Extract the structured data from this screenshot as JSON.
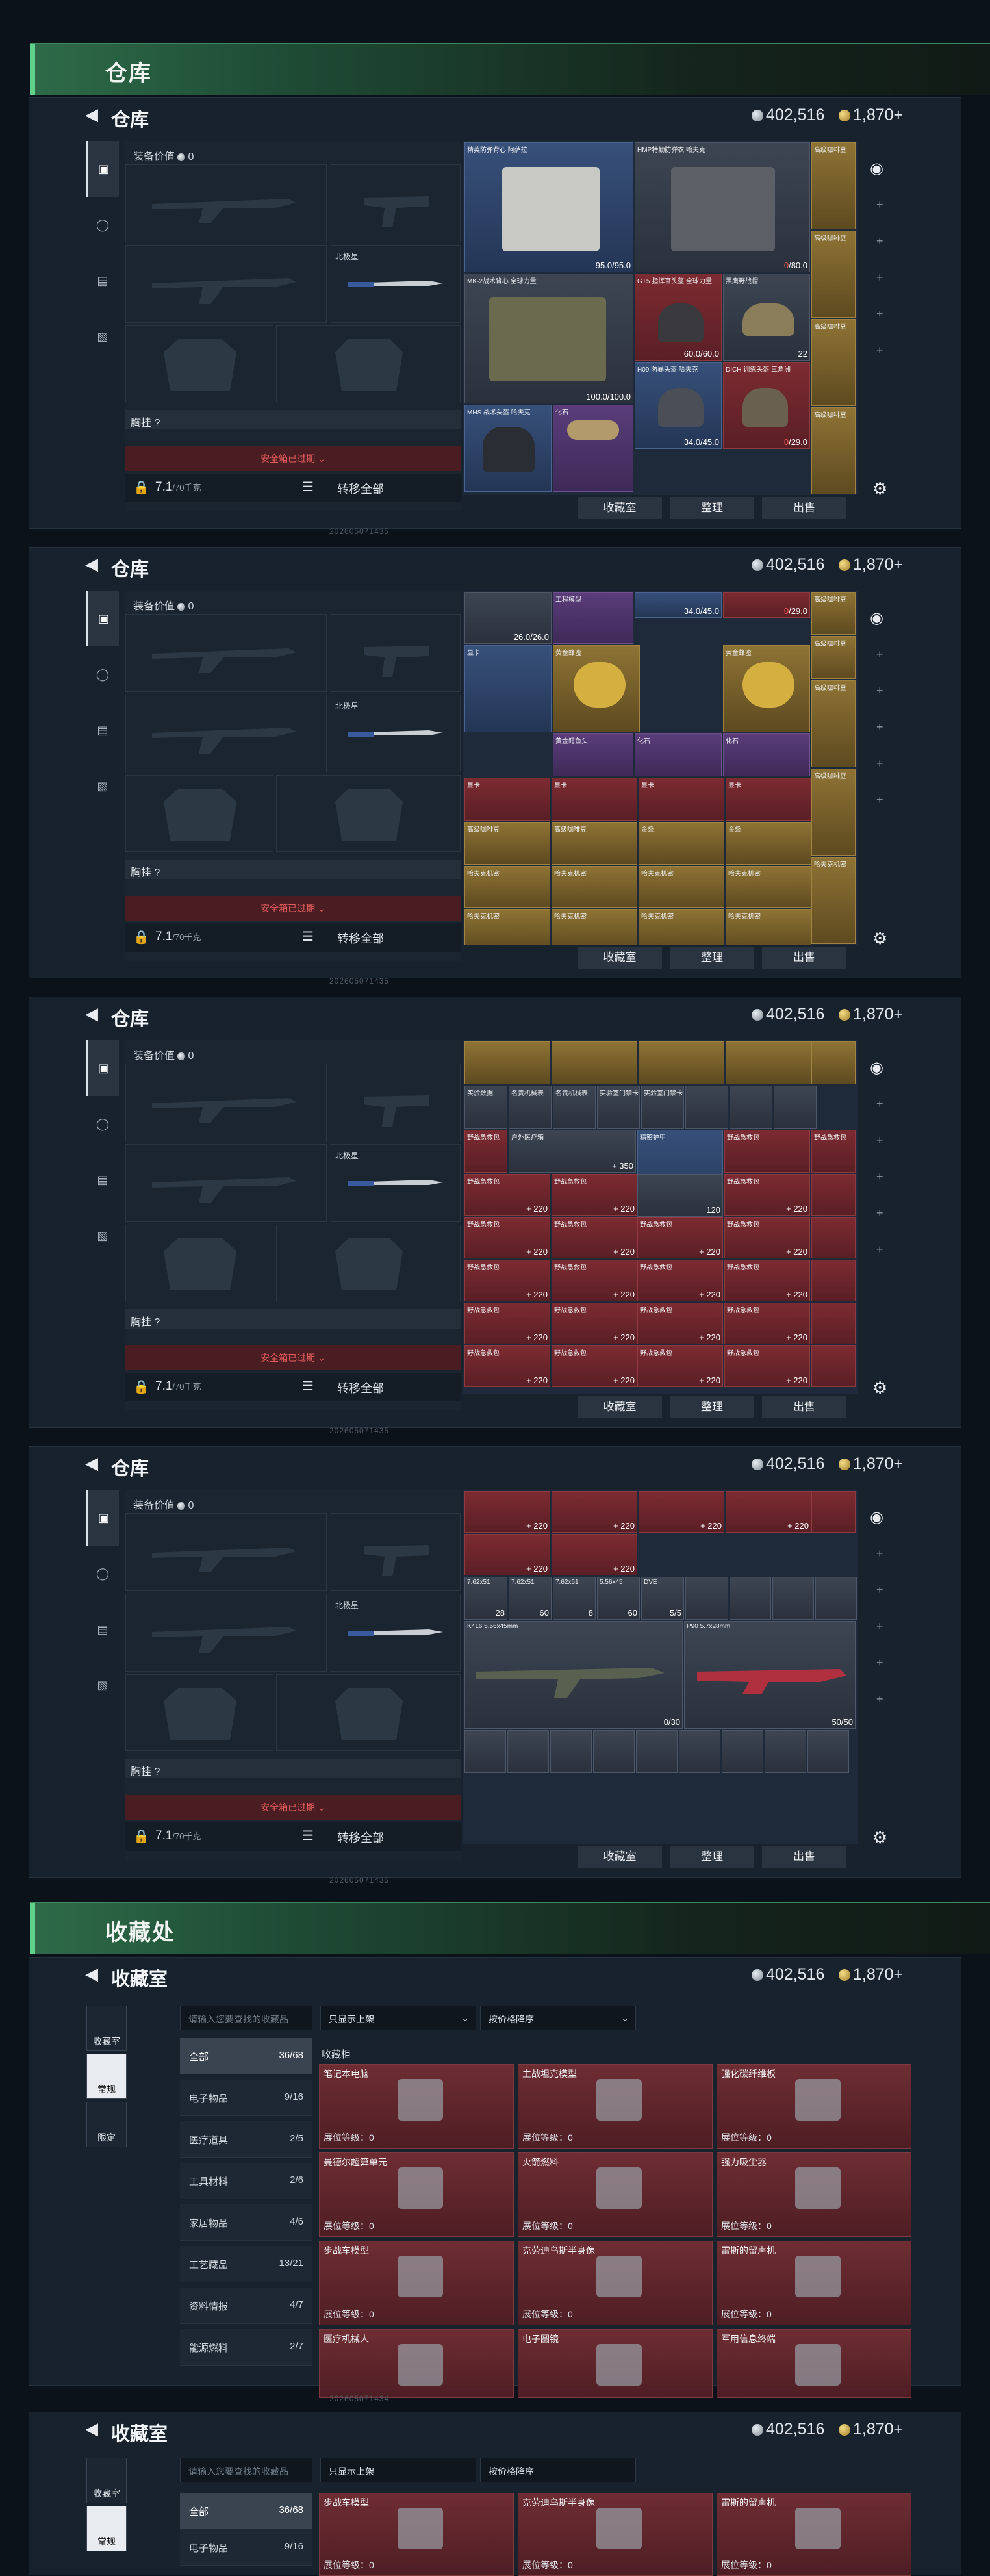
{
  "sections": {
    "warehouse_band": "仓库",
    "collection_band": "收藏处"
  },
  "currency": {
    "silver": "402,516",
    "gold": "1,870+"
  },
  "warehouse": {
    "title": "仓库",
    "equip_value_label": "装备价值",
    "equip_value": "0",
    "chest_label": "胸挂 ?",
    "safe_box": "安全箱已过期",
    "capacity": "7.1",
    "capacity_max": "/70千克",
    "transfer_all": "转移全部",
    "north_dagger": "北极星",
    "buttons": {
      "collection": "收藏室",
      "sort": "整理",
      "sell": "出售"
    },
    "session_id": "202605071435",
    "screen1_items": [
      {
        "name": "精英防弹背心\n阿萨拉",
        "value": "95.0/95.0"
      },
      {
        "name": "HMP特勤防弹衣\n哈夫克",
        "value": "0/80.0"
      },
      {
        "name": "MK-2战术背心\n全球力量",
        "value": "100.0/100.0"
      },
      {
        "name": "GT5 指挥官头盔\n全球力量",
        "value": "60.0/60.0"
      },
      {
        "name": "H09 防暴头盔\n哈夫克",
        "value": "34.0/45.0"
      },
      {
        "name": "DICH 训练头盔\n三角洲",
        "value": "0/29.0"
      },
      {
        "name": "MHS 战术头盔\n哈夫克",
        "value": ""
      },
      {
        "name": "化石",
        "value": ""
      },
      {
        "name": "工程模型",
        "value": ""
      },
      {
        "name": "高级咖啡豆",
        "value": ""
      },
      {
        "name": "黑鹰野战帽",
        "value": "22"
      }
    ],
    "screen2_items": [
      "工程模型",
      "高级咖啡豆",
      "黄金蜂蜜",
      "黄金鳄鱼头",
      "化石",
      "显卡",
      "金条",
      "哈夫克机密"
    ],
    "screen3_items": [
      "实验数据",
      "野战急救包",
      "户外医疗箱",
      "精密护甲",
      "名贵机械表",
      "实验室门禁卡"
    ],
    "screen3_values": [
      "350",
      "120",
      "220"
    ],
    "screen4_weapons": [
      {
        "name": "K416",
        "cal": "5.56x45mm",
        "ammo": "0/30"
      },
      {
        "name": "P90",
        "cal": "5.7x28mm",
        "ammo": "50/50"
      }
    ],
    "screen4_ammo": [
      {
        "name": "7.62x51",
        "count": "28"
      },
      {
        "name": "7.62x51",
        "count": "60"
      },
      {
        "name": "7.62x51",
        "count": "8"
      },
      {
        "name": "5.56x45",
        "count": "60"
      },
      {
        "name": "DVE",
        "count": "5/5"
      }
    ]
  },
  "collection": {
    "title": "收藏室",
    "tabs": [
      "收藏室",
      "常规",
      "限定"
    ],
    "search_placeholder": "请输入您要查找的收藏品",
    "filter1": "只显示上架",
    "filter2": "按价格降序",
    "cabinet_label": "收藏柜",
    "categories": [
      {
        "label": "全部",
        "count": "36/68"
      },
      {
        "label": "电子物品",
        "count": "9/16"
      },
      {
        "label": "医疗道具",
        "count": "2/5"
      },
      {
        "label": "工具材料",
        "count": "2/6"
      },
      {
        "label": "家居物品",
        "count": "4/6"
      },
      {
        "label": "工艺藏品",
        "count": "13/21"
      },
      {
        "label": "资料情报",
        "count": "4/7"
      },
      {
        "label": "能源燃料",
        "count": "2/7"
      }
    ],
    "level_label": "展位等级：0",
    "cards": [
      [
        "笔记本电脑",
        "主战坦克模型",
        "强化碳纤维板"
      ],
      [
        "曼德尔超算单元",
        "火箭燃料",
        "强力吸尘器"
      ],
      [
        "步战车模型",
        "克劳迪乌斯半身像",
        "雷斯的留声机"
      ],
      [
        "医疗机械人",
        "电子圆镜",
        "军用信息终端"
      ]
    ],
    "second_cards": [
      "步战车模型",
      "克劳迪乌斯半身像",
      "雷斯的留声机"
    ],
    "session_id": "202605071434"
  },
  "colors": {
    "accent_green": "#5fd18a",
    "red_slot": "#7c2b31",
    "blue_slot": "#37507a",
    "gold_slot": "#8e7334"
  }
}
